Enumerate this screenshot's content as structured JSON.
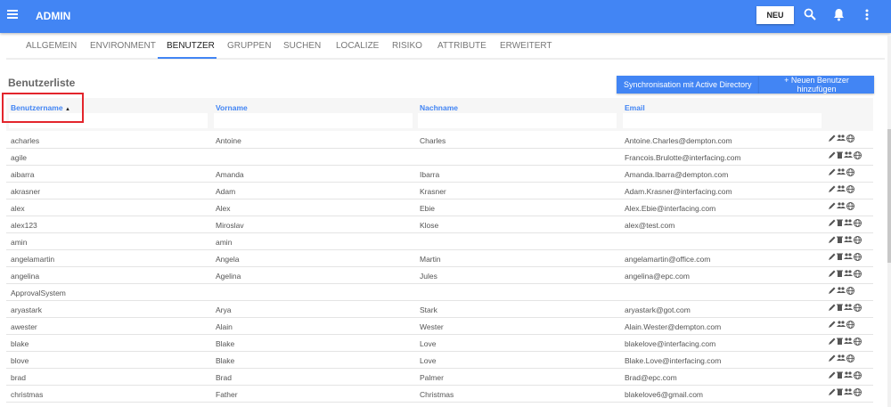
{
  "header": {
    "title": "ADMIN",
    "new_label": "NEU"
  },
  "tabs": [
    "ALLGEMEIN",
    "ENVIRONMENT",
    "BENUTZER",
    "GRUPPEN",
    "SUCHEN",
    "LOCALIZE",
    "RISIKO",
    "ATTRIBUTE",
    "ERWEITERT"
  ],
  "active_tab": "BENUTZER",
  "page": {
    "title": "Benutzerliste",
    "sync_label": "Synchronisation mit Active Directory",
    "add_label": "+ Neuen Benutzer hinzufügen"
  },
  "columns": {
    "username": "Benutzername",
    "sort": "▲",
    "firstname": "Vorname",
    "lastname": "Nachname",
    "email": "Email"
  },
  "rows": [
    {
      "u": "acharles",
      "f": "Antoine",
      "l": "Charles",
      "e": "Antoine.Charles@dempton.com",
      "del": false
    },
    {
      "u": "agile",
      "f": "",
      "l": "",
      "e": "Francois.Brulotte@interfacing.com",
      "del": true
    },
    {
      "u": "aibarra",
      "f": "Amanda",
      "l": "Ibarra",
      "e": "Amanda.Ibarra@dempton.com",
      "del": false
    },
    {
      "u": "akrasner",
      "f": "Adam",
      "l": "Krasner",
      "e": "Adam.Krasner@interfacing.com",
      "del": false
    },
    {
      "u": "alex",
      "f": "Alex",
      "l": "Ebie",
      "e": "Alex.Ebie@interfacing.com",
      "del": false
    },
    {
      "u": "alex123",
      "f": "Miroslav",
      "l": "Klose",
      "e": "alex@test.com",
      "del": true
    },
    {
      "u": "amin",
      "f": "amin",
      "l": "",
      "e": "",
      "del": true
    },
    {
      "u": "angelamartin",
      "f": "Angela",
      "l": "Martin",
      "e": "angelamartin@office.com",
      "del": true
    },
    {
      "u": "angelina",
      "f": "Agelina",
      "l": "Jules",
      "e": "angelina@epc.com",
      "del": true
    },
    {
      "u": "ApprovalSystem",
      "f": "",
      "l": "",
      "e": "",
      "del": false
    },
    {
      "u": "aryastark",
      "f": "Arya",
      "l": "Stark",
      "e": "aryastark@got.com",
      "del": true
    },
    {
      "u": "awester",
      "f": "Alain",
      "l": "Wester",
      "e": "Alain.Wester@dempton.com",
      "del": false
    },
    {
      "u": "blake",
      "f": "Blake",
      "l": "Love",
      "e": "blakelove@interfacing.com",
      "del": true
    },
    {
      "u": "blove",
      "f": "Blake",
      "l": "Love",
      "e": "Blake.Love@interfacing.com",
      "del": false
    },
    {
      "u": "brad",
      "f": "Brad",
      "l": "Palmer",
      "e": "Brad@epc.com",
      "del": true
    },
    {
      "u": "christmas",
      "f": "Father",
      "l": "Christmas",
      "e": "blakelove6@gmail.com",
      "del": true
    }
  ]
}
